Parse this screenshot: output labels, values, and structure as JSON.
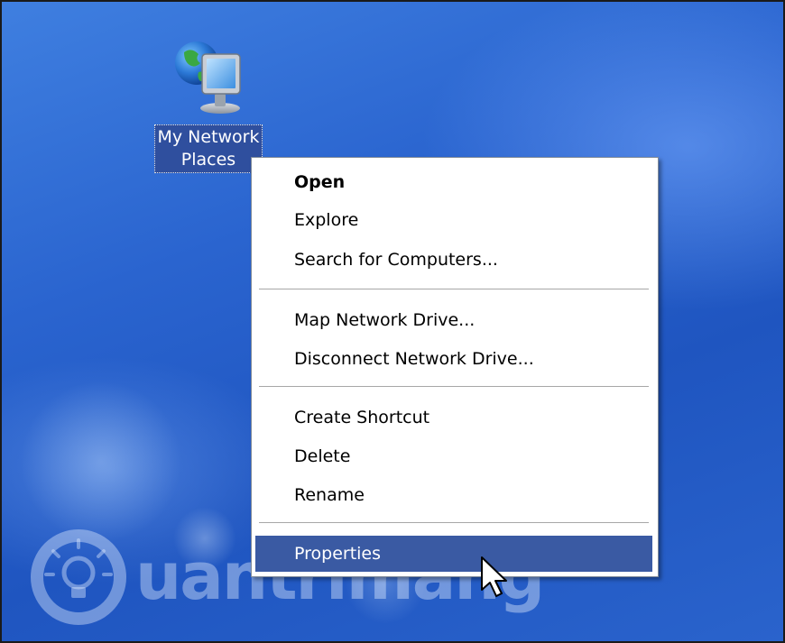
{
  "desktop": {
    "icon": {
      "label_line1": "My Network",
      "label_line2": "Places",
      "icon": "network-places-icon"
    }
  },
  "context_menu": {
    "items": [
      {
        "label": "Open",
        "bold": true
      },
      {
        "label": "Explore"
      },
      {
        "label": "Search for Computers..."
      },
      {
        "label": "Map Network Drive..."
      },
      {
        "label": "Disconnect Network Drive..."
      },
      {
        "label": "Create Shortcut"
      },
      {
        "label": "Delete"
      },
      {
        "label": "Rename"
      },
      {
        "label": "Properties",
        "highlighted": true
      }
    ]
  },
  "watermark": {
    "text": "uantrimang",
    "logo": "lightbulb-logo"
  },
  "colors": {
    "desktop": "#2a64cf",
    "selection": "#3a5aa3",
    "menu_bg": "#ffffff"
  },
  "cursor": {
    "icon": "arrow-cursor-icon"
  }
}
